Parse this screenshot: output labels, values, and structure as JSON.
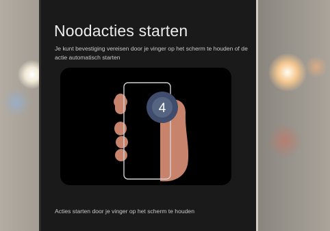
{
  "screen": {
    "title": "Noodacties starten",
    "description": "Je kunt bevestiging vereisen door je vinger op het scherm te houden of de actie automatisch starten",
    "illustration": {
      "countdown_value": "4",
      "icon": "hand-holding-phone-icon"
    },
    "footer_text": "Acties starten door je vinger op het scherm te houden"
  },
  "colors": {
    "screen_background": "#1a1a1a",
    "illustration_background": "#000000",
    "hand": "#c8836c",
    "countdown_circle": "#3f4c6b",
    "text_primary": "#ececec",
    "text_secondary": "#c9c9c9"
  }
}
